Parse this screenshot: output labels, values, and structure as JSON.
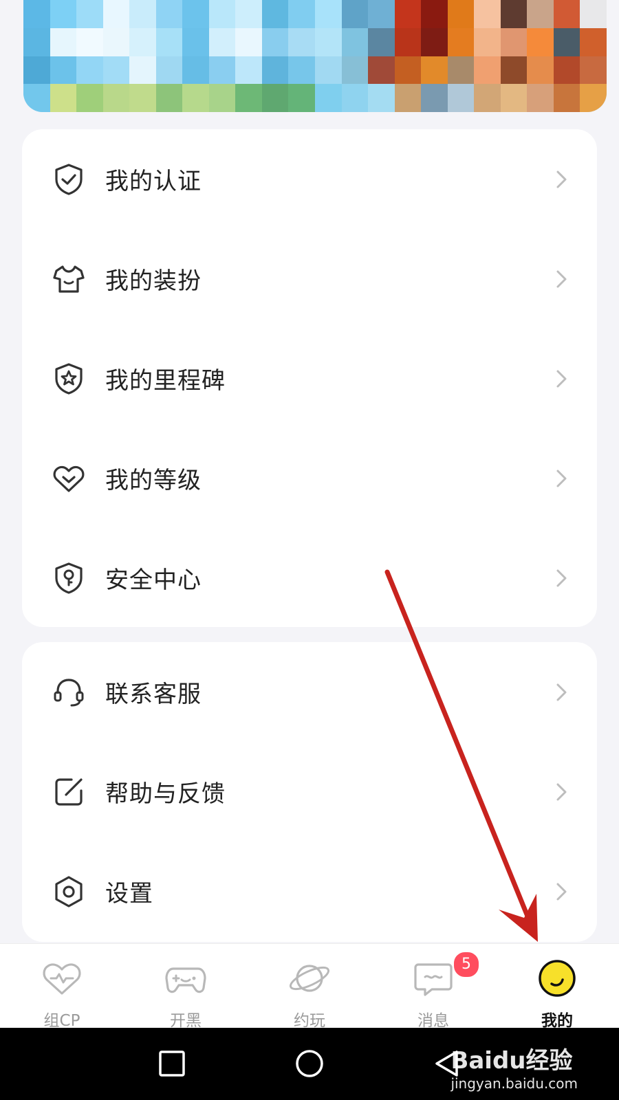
{
  "banner": {
    "image_desc": ""
  },
  "menu_group_1": {
    "items": [
      {
        "label": "我的认证",
        "icon": "shield-check-icon"
      },
      {
        "label": "我的装扮",
        "icon": "shirt-icon"
      },
      {
        "label": "我的里程碑",
        "icon": "star-badge-icon"
      },
      {
        "label": "我的等级",
        "icon": "heart-chevron-icon"
      },
      {
        "label": "安全中心",
        "icon": "shield-key-icon"
      }
    ]
  },
  "menu_group_2": {
    "items": [
      {
        "label": "联系客服",
        "icon": "headset-icon"
      },
      {
        "label": "帮助与反馈",
        "icon": "edit-icon"
      },
      {
        "label": "设置",
        "icon": "hexagon-gear-icon"
      }
    ]
  },
  "bottom_nav": {
    "items": [
      {
        "label": "组CP",
        "icon": "heart-pulse-icon"
      },
      {
        "label": "开黑",
        "icon": "gamepad-icon"
      },
      {
        "label": "约玩",
        "icon": "planet-icon"
      },
      {
        "label": "消息",
        "icon": "chat-icon",
        "badge": "5"
      },
      {
        "label": "我的",
        "icon": "avatar-icon",
        "active": true
      }
    ]
  },
  "watermark": {
    "line1": "Baidu经验",
    "line2": "jingyan.baidu.com"
  },
  "colors": {
    "background": "#f4f4f8",
    "card": "#ffffff",
    "badge": "#ff4d5e",
    "arrow": "#c8231e"
  }
}
